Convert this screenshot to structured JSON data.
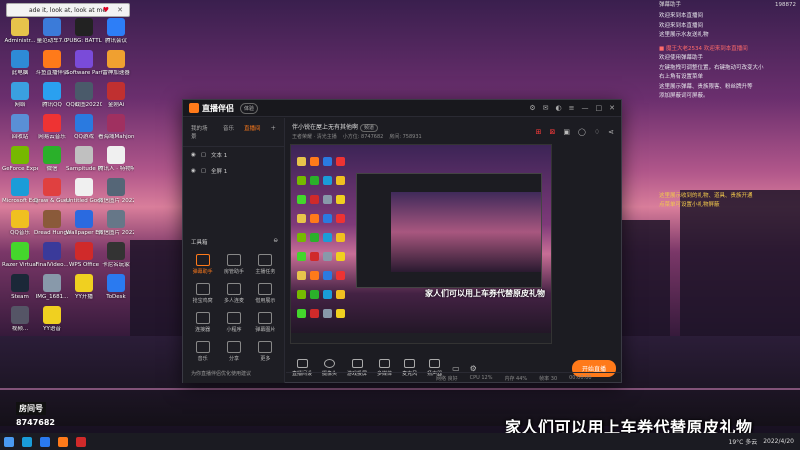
{
  "url_chip": {
    "text": "ade it, look at, look at me"
  },
  "desktop_icons": [
    {
      "label": "Administr...",
      "color": "#e7c44b"
    },
    {
      "label": "量范动车7.0",
      "color": "#3b7bd9"
    },
    {
      "label": "PUBG: BATTLEGR...",
      "color": "#222"
    },
    {
      "label": "腾讯会议",
      "color": "#2d7ef7"
    },
    {
      "label": "此电脑",
      "color": "#2e8bd6"
    },
    {
      "label": "斗鱼直播伴侣",
      "color": "#ff7a1a"
    },
    {
      "label": "Software Part",
      "color": "#7a4bd9"
    },
    {
      "label": "雷神加速器",
      "color": "#f0a030"
    },
    {
      "label": "网络",
      "color": "#3aa0e0"
    },
    {
      "label": "腾讯QQ",
      "color": "#2aa0f0"
    },
    {
      "label": "QQ截图20220320...",
      "color": "#4a5a6a"
    },
    {
      "label": "金刚Ai",
      "color": "#c03030"
    },
    {
      "label": "回收站",
      "color": "#5a8fd6"
    },
    {
      "label": "网易云音乐",
      "color": "#e33"
    },
    {
      "label": "QQ游戏",
      "color": "#2a7ae0"
    },
    {
      "label": "看海域Mahjong...",
      "color": "#a03060"
    },
    {
      "label": "GeForce Experience",
      "color": "#76b900"
    },
    {
      "label": "微信",
      "color": "#2ab02a"
    },
    {
      "label": "Sampitude Pro X1 Suite",
      "color": "#c0c0c0"
    },
    {
      "label": "腾讯人 · 特物特主播",
      "color": "#f0f0f0"
    },
    {
      "label": "Microsoft Edge",
      "color": "#1a9cd8"
    },
    {
      "label": "Draw & Guess",
      "color": "#e04040"
    },
    {
      "label": "Untitled Goose...",
      "color": "#f0f0f0"
    },
    {
      "label": "微信图片 20220130...",
      "color": "#556677"
    },
    {
      "label": "QQ音乐",
      "color": "#f0c020"
    },
    {
      "label": "Dread Hunger",
      "color": "#8a5a3a"
    },
    {
      "label": "Wallpaper Engine:...",
      "color": "#2a6ae0"
    },
    {
      "label": "微信图片 20220321...",
      "color": "#667788"
    },
    {
      "label": "Razer Virtual Ac...",
      "color": "#44d62c"
    },
    {
      "label": "FinalVideo...",
      "color": "#3a3a9a"
    },
    {
      "label": "WPS Office",
      "color": "#d02a2a"
    },
    {
      "label": "卡尼名玩家",
      "color": "#333"
    },
    {
      "label": "Steam",
      "color": "#1b2838"
    },
    {
      "label": "IMG_1681...",
      "color": "#8899aa"
    },
    {
      "label": "YY开播",
      "color": "#f0d020"
    },
    {
      "label": "ToDesk",
      "color": "#2a7af0"
    },
    {
      "label": "视频...",
      "color": "#556"
    },
    {
      "label": "YY语音",
      "color": "#f0d020"
    }
  ],
  "chat": {
    "header": "弹幕助手",
    "viewers": "198872",
    "lines": [
      {
        "text": "欢迎来到本直播间",
        "cls": ""
      },
      {
        "text": "欢迎来到本直播间",
        "cls": ""
      },
      {
        "text": "这里展示水友送礼物",
        "cls": ""
      },
      {
        "text": "■ 魔王大老2534 欢迎来到本直播间",
        "cls": "red"
      },
      {
        "text": "欢迎使用弹幕助手",
        "cls": ""
      },
      {
        "text": "左键拖拽可调整位置，右键拖动可改变大小",
        "cls": ""
      },
      {
        "text": "右上角有设置菜单",
        "cls": ""
      },
      {
        "text": "这里展示弹幕、贵族限客、粉丝牌升等",
        "cls": ""
      },
      {
        "text": "添加屏蔽词可屏蔽。",
        "cls": ""
      },
      {
        "text": "这里展示收到的礼物、道具、贵族开通",
        "cls": "gold"
      },
      {
        "text": "点菜单可设置小礼物屏蔽",
        "cls": "gold"
      }
    ]
  },
  "app": {
    "name": "直播伴侣",
    "version_badge": "体验",
    "tabs": [
      "我的场景",
      "音乐",
      "直播间"
    ],
    "sources": [
      "文本 1",
      "全屏 1"
    ],
    "tools_header": "工具箱",
    "tools": [
      {
        "label": "弹幕助手",
        "active": true
      },
      {
        "label": "房管助手",
        "active": false
      },
      {
        "label": "主播任务",
        "active": false
      },
      {
        "label": "抢宝鸡窝",
        "active": false
      },
      {
        "label": "多人连麦",
        "active": false
      },
      {
        "label": "借用展示",
        "active": false
      },
      {
        "label": "连接器",
        "active": false
      },
      {
        "label": "小程序",
        "active": false
      },
      {
        "label": "弹幕图片",
        "active": false
      },
      {
        "label": "音乐",
        "active": false
      },
      {
        "label": "分享",
        "active": false
      },
      {
        "label": "更多",
        "active": false
      }
    ],
    "left_footer": "为你直播伴侣优化使用建议",
    "room_title": "伴小锐在屋上无有其他啊",
    "room_tag": "频道",
    "room_sub": [
      "王者荣耀 · 清光主播",
      "小方位: 8747682",
      "房间: 758931"
    ],
    "preview_caption": "家人们可以用上车券代替原皮礼物",
    "bottom_buttons": [
      "直播间设",
      "摄像头",
      "游戏投屏",
      "多媒体",
      "麦克风",
      "扬声器"
    ],
    "go_live": "开始直播",
    "status": [
      "网络 良好",
      "CPU 12%",
      "内存 44%",
      "帧率 30",
      "00:00:00"
    ]
  },
  "big_caption": "家人们可以用上车券代替原皮礼物",
  "room_logo": {
    "label": "房间号",
    "id": "8747682"
  },
  "taskbar": {
    "weather": "19°C 多云",
    "time": "2022/4/20"
  }
}
